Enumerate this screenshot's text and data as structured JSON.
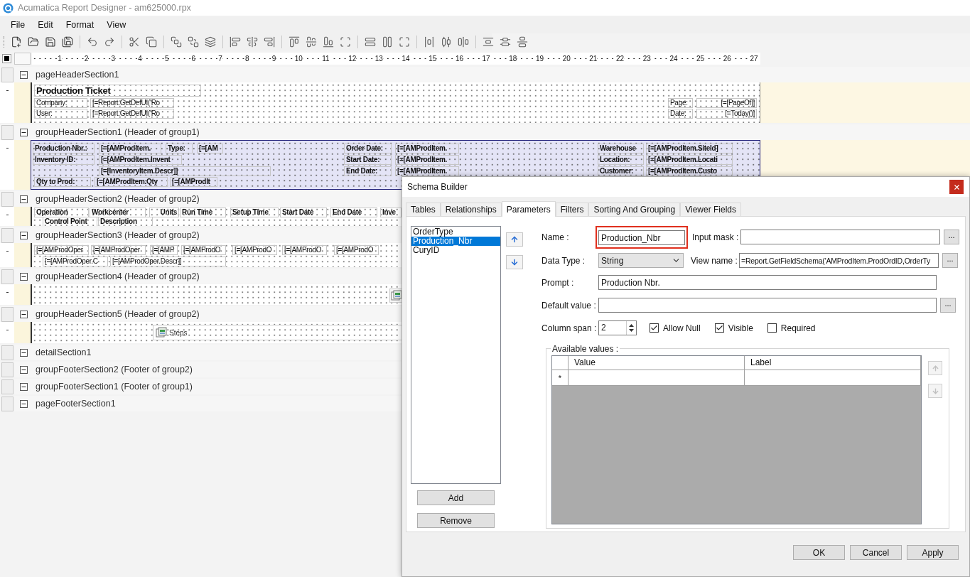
{
  "window": {
    "title": "Acumatica Report Designer - am625000.rpx"
  },
  "menu": [
    {
      "label": "File"
    },
    {
      "label": "Edit"
    },
    {
      "label": "Format"
    },
    {
      "label": "View"
    }
  ],
  "ruler": [
    "1",
    "2",
    "3",
    "4",
    "5",
    "6",
    "7",
    "8",
    "9",
    "10",
    "11",
    "12",
    "13",
    "14",
    "15",
    "16",
    "17",
    "18",
    "19",
    "20",
    "21",
    "22",
    "23",
    "24",
    "25",
    "26",
    "27"
  ],
  "sections": [
    {
      "title": "pageHeaderSection1",
      "expanded": true,
      "selected": false,
      "fields": [
        {
          "kind": "textbox",
          "text": "Production Ticket"
        },
        {
          "kind": "textbox",
          "text": "Company:"
        },
        {
          "kind": "textbox",
          "text": "[=Report.GetDefUI('Ro"
        },
        {
          "kind": "textbox",
          "text": "Page:"
        },
        {
          "kind": "textbox",
          "text": "[=[PageOf]]"
        },
        {
          "kind": "textbox",
          "text": "User:"
        },
        {
          "kind": "textbox",
          "text": "[=Report.GetDefUI('Ro"
        },
        {
          "kind": "textbox",
          "text": "Date:"
        },
        {
          "kind": "textbox",
          "text": "[=Today()]"
        }
      ]
    },
    {
      "title": "groupHeaderSection1 (Header of group1)",
      "expanded": true,
      "selected": true,
      "fields": [
        {
          "kind": "textbox",
          "text": "Production Nbr.:"
        },
        {
          "kind": "textbox",
          "text": "[=[AMProdItem."
        },
        {
          "kind": "textbox",
          "text": "Type:"
        },
        {
          "kind": "textbox",
          "text": "[=[AM"
        },
        {
          "kind": "textbox",
          "text": "Order Date:"
        },
        {
          "kind": "textbox",
          "text": "[=[AMProdItem."
        },
        {
          "kind": "textbox",
          "text": "Warehouse"
        },
        {
          "kind": "textbox",
          "text": "[=[AMProdItem.SiteId]"
        },
        {
          "kind": "textbox",
          "text": "Inventory ID:"
        },
        {
          "kind": "textbox",
          "text": "[=[AMProdItem.Invent"
        },
        {
          "kind": "textbox",
          "text": "Start Date:"
        },
        {
          "kind": "textbox",
          "text": "[=[AMProdItem."
        },
        {
          "kind": "textbox",
          "text": "Location:"
        },
        {
          "kind": "textbox",
          "text": "[=[AMProdItem.Locati"
        },
        {
          "kind": "textbox",
          "text": "[=[InventoryItem.Descr]]"
        },
        {
          "kind": "textbox",
          "text": "End Date:"
        },
        {
          "kind": "textbox",
          "text": "[=[AMProdItem."
        },
        {
          "kind": "textbox",
          "text": "Customer:"
        },
        {
          "kind": "textbox",
          "text": "[=[AMProdItem.Custo"
        },
        {
          "kind": "textbox",
          "text": "Qty to Prod:"
        },
        {
          "kind": "textbox",
          "text": "[=[AMProdItem.Qty"
        },
        {
          "kind": "textbox",
          "text": "[=[AMProdIt"
        }
      ]
    },
    {
      "title": "groupHeaderSection2 (Header of group2)",
      "expanded": true,
      "selected": false,
      "fields": [
        {
          "kind": "textbox",
          "text": "Operation"
        },
        {
          "kind": "textbox",
          "text": "Workcenter"
        },
        {
          "kind": "textbox",
          "text": "Units"
        },
        {
          "kind": "textbox",
          "text": "Run Time"
        },
        {
          "kind": "textbox",
          "text": "Setup Time"
        },
        {
          "kind": "textbox",
          "text": "Start Date"
        },
        {
          "kind": "textbox",
          "text": "End Date"
        },
        {
          "kind": "textbox",
          "text": "Inve"
        },
        {
          "kind": "textbox",
          "text": "Control Point"
        },
        {
          "kind": "textbox",
          "text": "Description"
        }
      ]
    },
    {
      "title": "groupHeaderSection3 (Header of group2)",
      "expanded": true,
      "selected": false,
      "fields": [
        {
          "kind": "textbox",
          "text": "[=[AMProdOper"
        },
        {
          "kind": "textbox",
          "text": "[=[AMProdOper"
        },
        {
          "kind": "textbox",
          "text": "[=[AMP"
        },
        {
          "kind": "textbox",
          "text": "[=[AMProdO"
        },
        {
          "kind": "textbox",
          "text": "[=[AMProdO"
        },
        {
          "kind": "textbox",
          "text": "[=[AMProdO"
        },
        {
          "kind": "textbox",
          "text": "[=[AMProdO"
        },
        {
          "kind": "textbox",
          "text": "[=[AMProdOper.C"
        },
        {
          "kind": "textbox",
          "text": "[=[AMProdOper.Descr]]"
        }
      ]
    },
    {
      "title": "groupHeaderSection4 (Header of group2)",
      "expanded": true,
      "selected": false,
      "fields": [
        {
          "kind": "subreport"
        }
      ]
    },
    {
      "title": "groupHeaderSection5 (Header of group2)",
      "expanded": true,
      "selected": false,
      "fields": [
        {
          "kind": "subreport",
          "text": "Steps"
        }
      ]
    },
    {
      "title": "detailSection1",
      "expanded": true
    },
    {
      "title": "groupFooterSection2 (Footer of group2)",
      "expanded": true
    },
    {
      "title": "groupFooterSection1 (Footer of group1)",
      "expanded": true
    },
    {
      "title": "pageFooterSection1",
      "expanded": true
    }
  ],
  "dialog": {
    "title": "Schema Builder",
    "tabs": [
      {
        "label": "Tables",
        "selected": false
      },
      {
        "label": "Relationships",
        "selected": false
      },
      {
        "label": "Parameters",
        "selected": true
      },
      {
        "label": "Filters",
        "selected": false
      },
      {
        "label": "Sorting And Grouping",
        "selected": false
      },
      {
        "label": "Viewer Fields",
        "selected": false
      }
    ],
    "parameters": [
      {
        "label": "OrderType",
        "selected": false
      },
      {
        "label": "Production_Nbr",
        "selected": true
      },
      {
        "label": "CuryID",
        "selected": false
      }
    ],
    "name": {
      "label": "Name :",
      "value": "Production_Nbr",
      "highlighted": true
    },
    "input_mask": {
      "label": "Input mask :",
      "browse": "..."
    },
    "data_type": {
      "label": "Data Type :",
      "value": "String"
    },
    "view_name": {
      "label": "View name :",
      "value": "=Report.GetFieldSchema('AMProdItem.ProdOrdID,OrderTy",
      "browse": "..."
    },
    "prompt": {
      "label": "Prompt :",
      "value": "Production Nbr."
    },
    "default_value": {
      "label": "Default value :",
      "browse": "..."
    },
    "column_span": {
      "label": "Column span :",
      "value": "2"
    },
    "options": [
      {
        "label": "Allow Null",
        "checked": true
      },
      {
        "label": "Visible",
        "checked": true
      },
      {
        "label": "Required",
        "checked": false
      }
    ],
    "available_values": {
      "title": "Available values :",
      "columns": [
        "Value",
        "Label"
      ],
      "new_row_marker": "*",
      "side_buttons": [
        {
          "kind": "up",
          "disabled": true
        },
        {
          "kind": "down",
          "disabled": true
        }
      ]
    },
    "list_buttons": [
      "Add",
      "Remove"
    ],
    "buttons": [
      "OK",
      "Cancel",
      "Apply"
    ]
  }
}
